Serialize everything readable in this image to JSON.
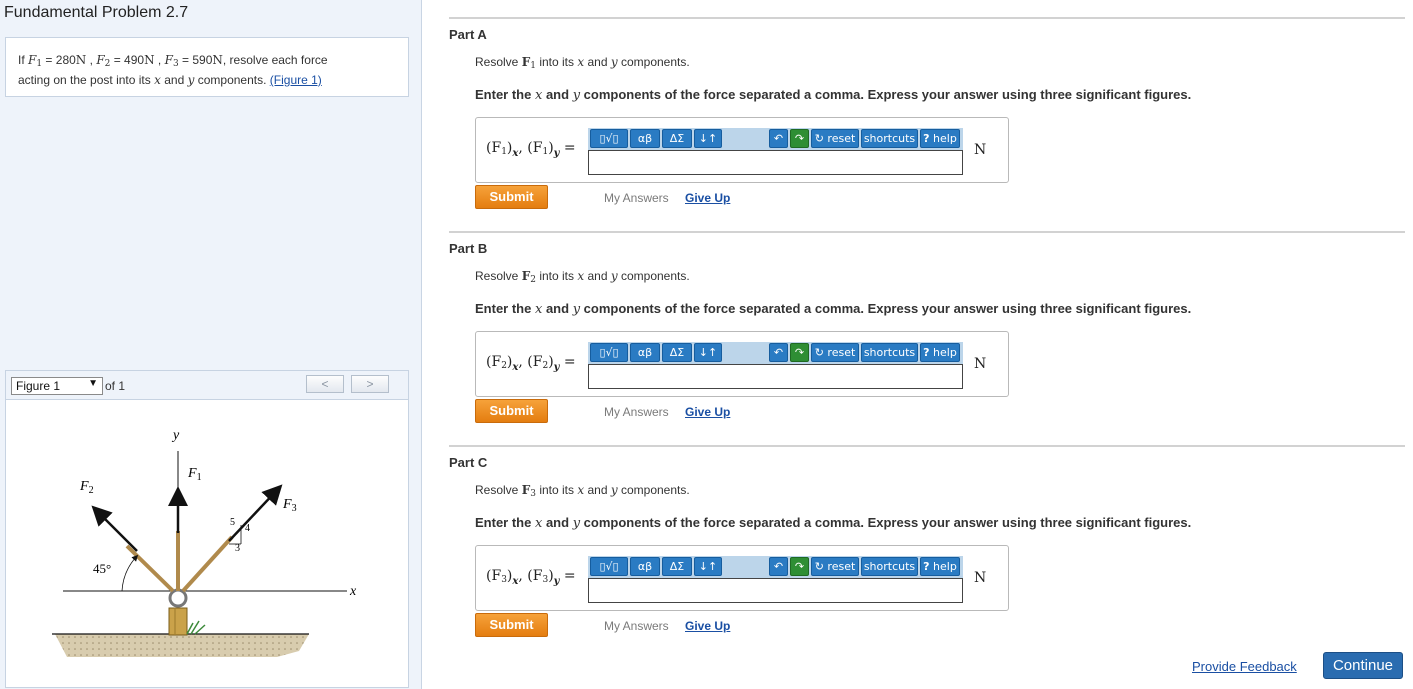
{
  "problem": {
    "title": "Fundamental Problem 2.7",
    "statement": {
      "prefix": "If",
      "f1_sym": "F",
      "f1_sub": "1",
      "f1_val": "= 280",
      "f1_unit": "N",
      "f2_sym": "F",
      "f2_sub": "2",
      "f2_val": "= 490",
      "f2_unit": "N",
      "f3_sym": "F",
      "f3_sub": "3",
      "f3_val": "= 590",
      "f3_unit": "N",
      "text1": ", resolve each force",
      "text2": "acting on the post into its",
      "x": "x",
      "and": "and",
      "y": "y",
      "text3": "components.",
      "figure_link": "(Figure 1)"
    }
  },
  "figure": {
    "selected": "Figure 1",
    "of_text": "of 1",
    "prev": "<",
    "next": ">",
    "labels": {
      "y_axis": "y",
      "x_axis": "x",
      "f1": "F",
      "f1_sub": "1",
      "f2": "F",
      "f2_sub": "2",
      "f3": "F",
      "f3_sub": "3",
      "angle": "45°",
      "tri_5": "5",
      "tri_4": "4",
      "tri_3": "3"
    }
  },
  "parts": [
    {
      "label": "Part A",
      "resolve": {
        "a": "Resolve",
        "force": "F",
        "sub": "1",
        "b": "into its",
        "x": "x",
        "and": "and",
        "y": "y",
        "c": "components."
      },
      "instruction_a": "Enter the",
      "instruction_x": "x",
      "instruction_and": "and",
      "instruction_y": "y",
      "instruction_b": "components of the force separated a comma. Express your answer using three significant figures.",
      "answer_label": {
        "open1": "(F",
        "sub1": "1",
        "close1": ")",
        "sx": "x",
        "comma": ",",
        "open2": "(F",
        "sub2": "1",
        "close2": ")",
        "sy": "y",
        "eq": "="
      },
      "unit": "N",
      "submit": "Submit",
      "my_answers": "My Answers",
      "give_up": "Give Up"
    },
    {
      "label": "Part B",
      "resolve": {
        "a": "Resolve",
        "force": "F",
        "sub": "2",
        "b": "into its",
        "x": "x",
        "and": "and",
        "y": "y",
        "c": "components."
      },
      "instruction_a": "Enter the",
      "instruction_x": "x",
      "instruction_and": "and",
      "instruction_y": "y",
      "instruction_b": "components of the force separated a comma. Express your answer using three significant figures.",
      "answer_label": {
        "open1": "(F",
        "sub1": "2",
        "close1": ")",
        "sx": "x",
        "comma": ",",
        "open2": "(F",
        "sub2": "2",
        "close2": ")",
        "sy": "y",
        "eq": "="
      },
      "unit": "N",
      "submit": "Submit",
      "my_answers": "My Answers",
      "give_up": "Give Up"
    },
    {
      "label": "Part C",
      "resolve": {
        "a": "Resolve",
        "force": "F",
        "sub": "3",
        "b": "into its",
        "x": "x",
        "and": "and",
        "y": "y",
        "c": "components."
      },
      "instruction_a": "Enter the",
      "instruction_x": "x",
      "instruction_and": "and",
      "instruction_y": "y",
      "instruction_b": "components of the force separated a comma. Express your answer using three significant figures.",
      "answer_label": {
        "open1": "(F",
        "sub1": "3",
        "close1": ")",
        "sx": "x",
        "comma": ",",
        "open2": "(F",
        "sub2": "3",
        "close2": ")",
        "sy": "y",
        "eq": "="
      },
      "unit": "N",
      "submit": "Submit",
      "my_answers": "My Answers",
      "give_up": "Give Up"
    }
  ],
  "toolbar": {
    "templates": "▯√▯",
    "greek": "αβ",
    "symbols": "ΔΣ",
    "arrows": "↓↑",
    "undo": "↶",
    "redo": "↷",
    "reset": "reset",
    "shortcuts": "shortcuts",
    "help": "help",
    "help_q": "?"
  },
  "footer": {
    "provide_feedback": "Provide Feedback",
    "continue": "Continue"
  },
  "colors": {
    "accent_blue": "#2a7bc3",
    "submit_orange": "#f19220",
    "continue_blue": "#2a6cb0",
    "link_blue": "#1a4fa3"
  }
}
